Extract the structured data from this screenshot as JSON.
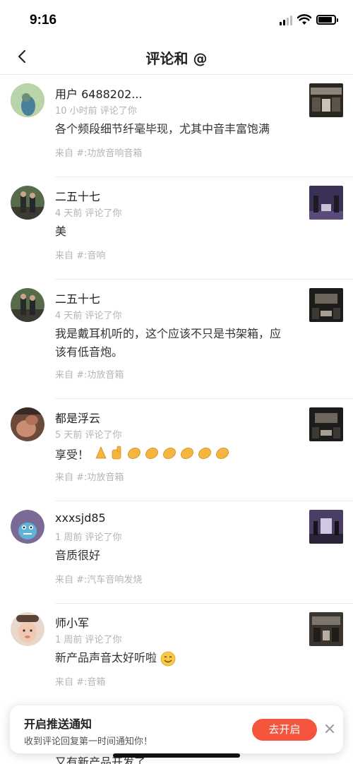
{
  "status_bar": {
    "time": "9:16"
  },
  "nav": {
    "title": "评论和 @"
  },
  "comments": [
    {
      "username": "用户 6488202...",
      "meta": "10 小时前 评论了你",
      "text": "各个频段细节纤毫毕现，尤其中音丰富饱满",
      "source": "来自 #:功放音响音箱"
    },
    {
      "username": "二五十七",
      "meta": "4 天前 评论了你",
      "text": "美",
      "source": "来自 #:音响"
    },
    {
      "username": "二五十七",
      "meta": "4 天前 评论了你",
      "text": "我是戴耳机听的，这个应该不只是书架箱，应该有低音炮。",
      "source": "来自 #:功放音箱"
    },
    {
      "username": "都是浮云",
      "meta": "5 天前 评论了你",
      "text": "享受！",
      "source": "来自 #:功放音箱"
    },
    {
      "username": "xxxsjd85",
      "meta": "1 周前 评论了你",
      "text": "音质很好",
      "source": "来自 #:汽车音响发烧"
    },
    {
      "username": "师小军",
      "meta": "1 周前 评论了你",
      "text": "新产品声音太好听啦",
      "source": "来自 #:音箱"
    }
  ],
  "peek": {
    "text": "又有新产品开发了"
  },
  "toast": {
    "title": "开启推送通知",
    "subtitle": "收到评论回复第一时间通知你！",
    "button": "去开启"
  },
  "colors": {
    "accent": "#f5553d",
    "muted": "#b3b3b3"
  }
}
